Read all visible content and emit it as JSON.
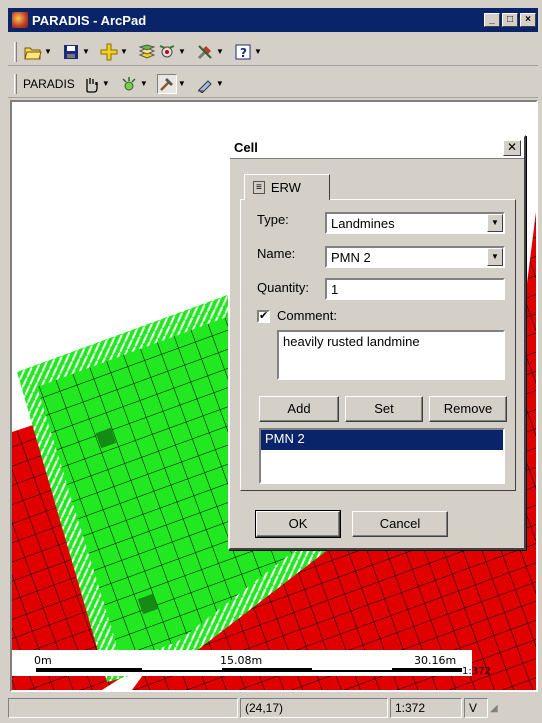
{
  "window": {
    "title": "PARADIS - ArcPad",
    "min_label": "_",
    "max_label": "□",
    "close_label": "×"
  },
  "toolbar_main": {
    "icons": [
      "folder-open-icon",
      "save-icon",
      "add-layer-icon",
      "layers-icon",
      "gps-icon",
      "tools-icon",
      "help-icon"
    ]
  },
  "toolbar_paradis": {
    "label": "PARADIS"
  },
  "map": {
    "scale_labels": {
      "start": "0m",
      "mid": "15.08m",
      "end": "30.16m"
    },
    "scale_ratio": "1:372",
    "colors": {
      "background": "#ffffff",
      "red_zone": "#e00000",
      "green_zone": "#22e822",
      "hatch": "#ffffff",
      "dark_cell": "#158a15",
      "grid_line": "#000000"
    }
  },
  "statusbar": {
    "coords": "(24,17)",
    "scale": "1:372",
    "mode": "V"
  },
  "dialog": {
    "title": "Cell",
    "tab_label": "ERW",
    "type_label": "Type:",
    "type_value": "Landmines",
    "name_label": "Name:",
    "name_value": "PMN 2",
    "quantity_label": "Quantity:",
    "quantity_value": "1",
    "comment_checked": true,
    "comment_label": "Comment:",
    "comment_value": "heavily rusted landmine",
    "add_label": "Add",
    "set_label": "Set",
    "remove_label": "Remove",
    "list_items": [
      "PMN 2"
    ],
    "ok_label": "OK",
    "cancel_label": "Cancel"
  }
}
